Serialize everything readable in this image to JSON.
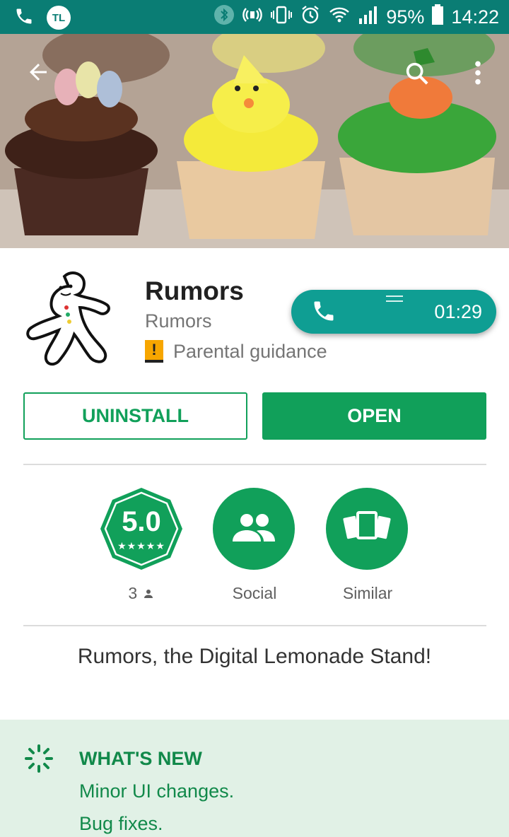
{
  "status_bar": {
    "left_badge": "TL",
    "battery_percent": "95%",
    "time": "14:22",
    "icons": [
      "phone-icon",
      "bluetooth-icon",
      "volume-icon",
      "vibrate-icon",
      "alarm-icon",
      "wifi-icon",
      "signal-icon",
      "battery-icon"
    ]
  },
  "app": {
    "title": "Rumors",
    "developer": "Rumors",
    "content_rating": "Parental guidance",
    "rating_glyph": "!"
  },
  "call": {
    "duration": "01:29"
  },
  "buttons": {
    "uninstall": "UNINSTALL",
    "open": "OPEN"
  },
  "stats": {
    "rating": "5.0",
    "stars": "★★★★★",
    "rating_count": "3",
    "social_label": "Social",
    "similar_label": "Similar"
  },
  "description": "Rumors, the Digital Lemonade Stand!",
  "whats_new": {
    "title": "WHAT'S NEW",
    "lines": [
      "Minor UI changes.",
      "Bug fixes."
    ]
  },
  "colors": {
    "status_bar": "#0a7d74",
    "accent_green": "#11a05a",
    "call_pill": "#0f9e93",
    "whats_new_bg": "#e1f1e6"
  }
}
